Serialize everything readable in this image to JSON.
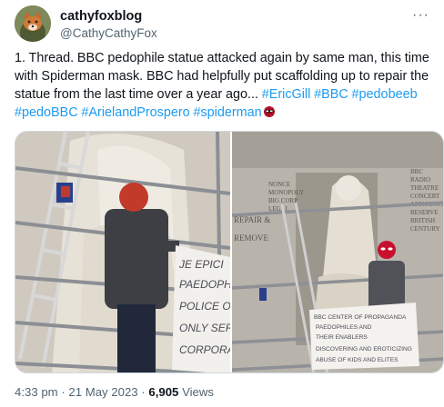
{
  "author": {
    "display_name": "cathyfoxblog",
    "handle": "@CathyCathyFox",
    "avatar_icon": "fox-avatar-icon"
  },
  "menu": {
    "more_label": "···"
  },
  "tweet": {
    "text": "1. Thread. BBC pedophile statue attacked again by same man, this time with Spiderman mask. BBC had helpfully put scaffolding up to repair the statue from the last time over a year ago... ",
    "hashtags": [
      "#EricGill",
      "#BBC",
      "#pedobeeb",
      "#pedoBBC",
      "#ArielandProspero",
      "#spiderman"
    ],
    "trailing_emoji": "spider-mask-emoji"
  },
  "media": {
    "left_banner_lines": [
      "JE EPICI",
      "PAEDOPH",
      "POLICE O",
      "ONLY SER",
      "CORPORA"
    ],
    "right_banner_lines": [
      "BBC CENTER OF PROPAGANDA",
      "PAEDOPHILES AND",
      "THEIR ENABLERS",
      "DISCOVERING AND EROTICIZING",
      "ABUSE OF KIDS AND ELITES"
    ],
    "right_stone_plaque_lines": [
      "BBC",
      "RADIO",
      "THEATRE",
      "CONCERT",
      "ANNOUNCE",
      "RESERVE",
      "BRITISH",
      "CENTURY"
    ],
    "right_left_plaque_lines": [
      "REPAIR &",
      "REMOVE"
    ],
    "right_center_plaque_lines": [
      "NONCE",
      "MONOPOLY",
      "BIG CORP",
      "LEGAL"
    ]
  },
  "footer": {
    "time": "4:33 pm",
    "separator": " · ",
    "date": "21 May 2023",
    "views_count": "6,905",
    "views_label": "Views"
  },
  "colors": {
    "link": "#1d9bf0",
    "secondary_text": "#536471",
    "primary_text": "#0f1419",
    "border": "#cfd9de"
  }
}
